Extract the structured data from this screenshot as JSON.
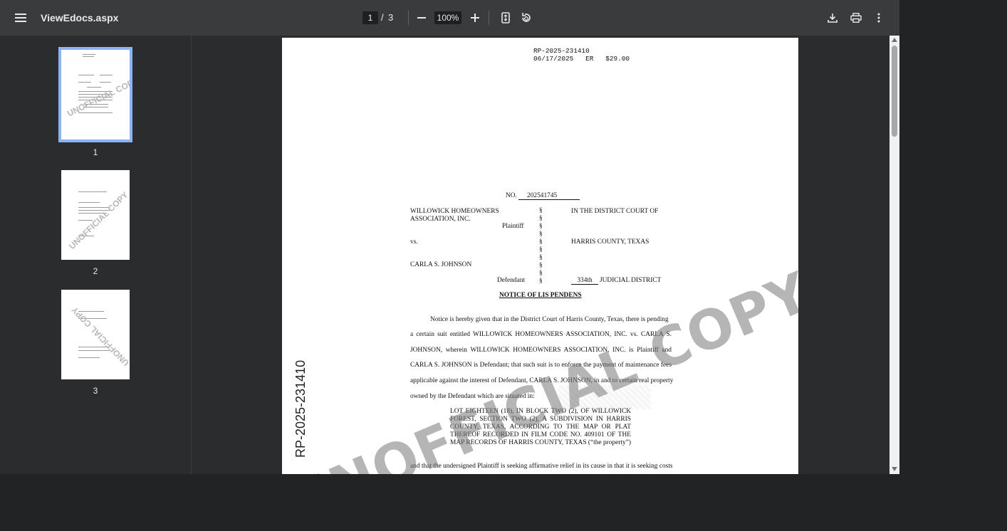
{
  "toolbar": {
    "title": "ViewEdocs.aspx",
    "current_page": "1",
    "page_separator": "/",
    "total_pages": "3",
    "zoom": "100%",
    "icons": [
      "menu-icon",
      "zoom-out-icon",
      "zoom-in-icon",
      "fit-page-icon",
      "rotate-icon",
      "download-icon",
      "print-icon",
      "more-vert-icon"
    ]
  },
  "thumbnails": [
    {
      "label": "1",
      "selected": true
    },
    {
      "label": "2",
      "selected": false
    },
    {
      "label": "3",
      "selected": false
    }
  ],
  "thumbnail_watermark": "UNOFFICIAL COPY",
  "document": {
    "header_line1": "RP-2025-231410",
    "header_line2": "06/17/2025   ER   $29.00",
    "case_no_label": "NO.",
    "case_no": "202541745",
    "plaintiff_line1": "WILLOWICK HOMEOWNERS",
    "plaintiff_line2": "ASSOCIATION, INC.",
    "plaintiff_label": "Plaintiff",
    "vs": "vs.",
    "defendant": "CARLA S. JOHNSON",
    "defendant_label": "Defendant",
    "section_sign": "§",
    "court_line1": "IN THE DISTRICT COURT OF",
    "court_line2": "HARRIS COUNTY, TEXAS",
    "court_number": "334th",
    "court_line3": "JUDICIAL DISTRICT",
    "notice_title": "NOTICE OF LIS PENDENS",
    "body_lines": [
      "Notice is hereby given that in the District Court of Harris County, Texas, there is pending",
      "a certain suit entitled WILLOWICK HOMEOWNERS ASSOCIATION, INC. vs. CARLA S.",
      "JOHNSON, wherein WILLOWICK HOMEOWNERS ASSOCIATION, INC. is Plaintiff and",
      "CARLA S. JOHNSON is Defendant; that such suit is to enforce the payment of maintenance fees",
      "applicable against the interest of Defendant, CARLA S. JOHNSON, in and to certain real property",
      "owned by the Defendant which are situated in:"
    ],
    "legal_lines": [
      "LOT EIGHTEEN (18), IN BLOCK TWO (2), OF WILLOWICK",
      "FOREST, SECTION TWO (2), A SUBDIVISION IN HARRIS",
      "COUNTY, TEXAS, ACCORDING TO THE MAP OR PLAT",
      "THEREOF RECORDED IN FILM CODE NO. 409101 OF THE",
      "MAP RECORDS OF HARRIS COUNTY, TEXAS (“the property”)"
    ],
    "closing_line": "and that the undersigned Plaintiff is seeking affirmative relief in its cause in that it is seeking costs",
    "side_stamp": "RP-2025-231410",
    "watermark": "UNOFFICIAL COPY"
  }
}
